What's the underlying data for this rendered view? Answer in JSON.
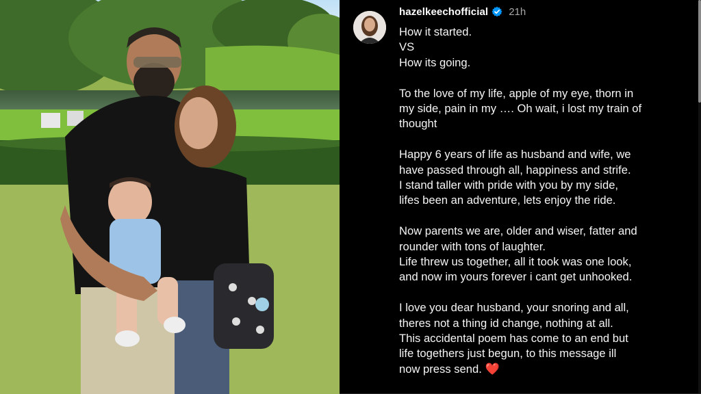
{
  "post": {
    "username": "hazelkeechofficial",
    "time_ago": "21h",
    "caption_lines": [
      "How it started.",
      "VS",
      "How its going.",
      "",
      "To the love of my life, apple of my eye, thorn in",
      "my side, pain in my …. Oh wait, i lost my train of",
      "thought",
      "",
      "Happy 6 years of life as husband and wife, we",
      "have passed through all, happiness and strife.",
      "I stand taller with pride with you by my side,",
      "lifes been an adventure, lets enjoy the ride.",
      "",
      "Now parents we are, older and wiser, fatter and",
      "rounder with tons of laughter.",
      "Life threw us together, all it took was one look,",
      "and now im yours forever i cant get unhooked.",
      "",
      "I love you dear husband, your snoring and all,",
      "theres not a thing id change, nothing at all.",
      "This accidental poem has come to an end but",
      "life togethers just begun, to this message ill",
      "now press send. "
    ],
    "end_emoji": "❤️"
  },
  "icons": {
    "verified": "verified-badge-icon",
    "avatar": "profile-avatar"
  },
  "colors": {
    "background": "#000000",
    "text": "#f5f5f5",
    "secondary_text": "#a8a8a8",
    "verified_blue": "#0095f6",
    "heart": "#e0243c"
  }
}
